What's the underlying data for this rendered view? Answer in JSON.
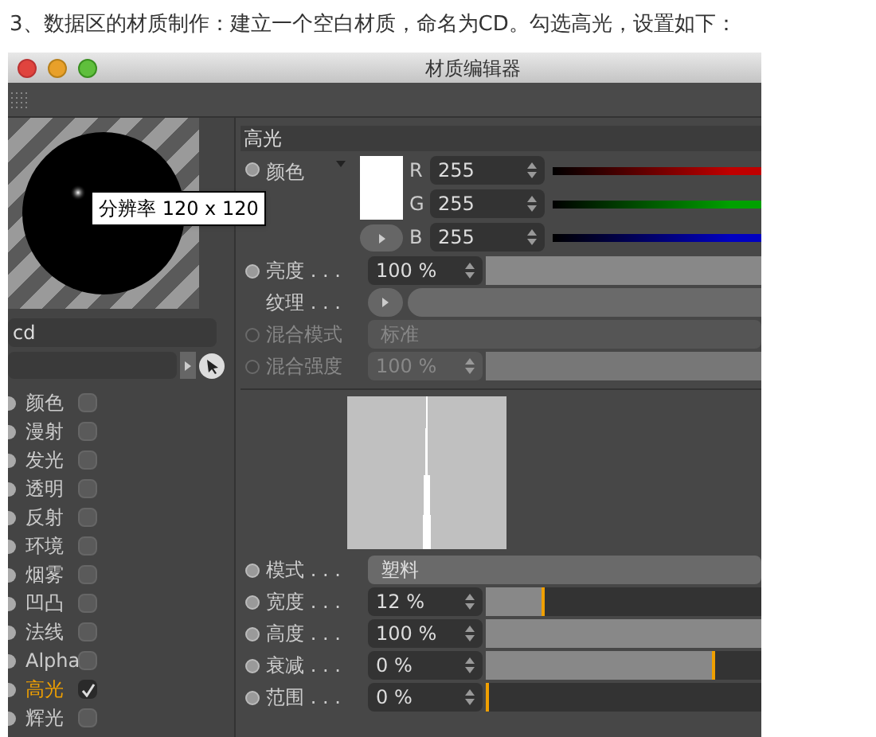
{
  "caption": "3、数据区的材质制作：建立一个空白材质，命名为CD。勾选高光，设置如下：",
  "window": {
    "title": "材质编辑器"
  },
  "preview": {
    "tooltip": "分辨率 120 x 120"
  },
  "material_name": "cd",
  "channels": [
    {
      "label": "颜色",
      "checked": false,
      "selected": false
    },
    {
      "label": "漫射",
      "checked": false,
      "selected": false
    },
    {
      "label": "发光",
      "checked": false,
      "selected": false
    },
    {
      "label": "透明",
      "checked": false,
      "selected": false
    },
    {
      "label": "反射",
      "checked": false,
      "selected": false
    },
    {
      "label": "环境",
      "checked": false,
      "selected": false
    },
    {
      "label": "烟雾",
      "checked": false,
      "selected": false
    },
    {
      "label": "凹凸",
      "checked": false,
      "selected": false
    },
    {
      "label": "法线",
      "checked": false,
      "selected": false
    },
    {
      "label": "Alpha",
      "checked": false,
      "selected": false
    },
    {
      "label": "高光",
      "checked": true,
      "selected": true
    },
    {
      "label": "辉光",
      "checked": false,
      "selected": false
    }
  ],
  "section": {
    "title": "高光",
    "color_label": "颜色",
    "components": [
      {
        "label": "R",
        "value": "255",
        "color": "#c00000"
      },
      {
        "label": "G",
        "value": "255",
        "color": "#00a000"
      },
      {
        "label": "B",
        "value": "255",
        "color": "#0000c0"
      }
    ],
    "params": [
      {
        "kind": "slider",
        "label": "亮度 . . .",
        "value": "100 %",
        "level": 1,
        "disabled": false
      },
      {
        "kind": "texture",
        "label": "纹理 . . .",
        "disabled": false
      },
      {
        "kind": "dropdown",
        "label": "混合模式",
        "value": "标准",
        "disabled": true
      },
      {
        "kind": "slider",
        "label": "混合强度",
        "value": "100 %",
        "level": 1,
        "disabled": true
      }
    ],
    "shape_params": [
      {
        "kind": "dropdown",
        "label": "模式 . . .",
        "value": "塑料",
        "disabled": false
      },
      {
        "kind": "slider",
        "label": "宽度 . . .",
        "value": "12 %",
        "level": 0.2,
        "disabled": false
      },
      {
        "kind": "slider",
        "label": "高度 . . .",
        "value": "100 %",
        "level": 1,
        "disabled": false
      },
      {
        "kind": "slider",
        "label": "衰减 . . .",
        "value": "0 %",
        "level": 0.82,
        "disabled": false
      },
      {
        "kind": "slider",
        "label": "范围 . . .",
        "value": "0 %",
        "level": 0,
        "disabled": false
      }
    ]
  }
}
